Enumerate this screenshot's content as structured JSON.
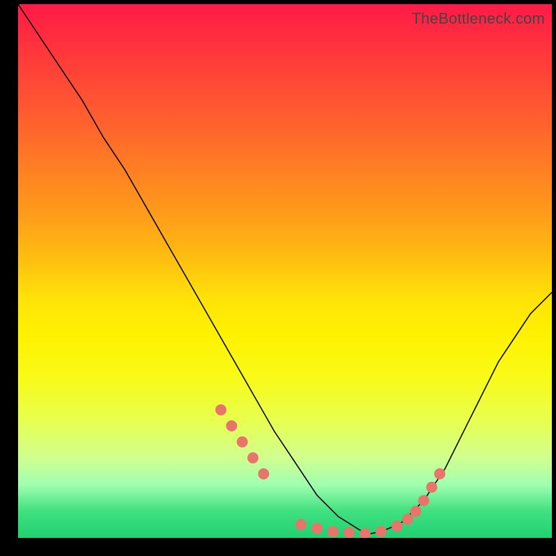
{
  "watermark": "TheBottleneck.com",
  "chart_data": {
    "type": "line",
    "title": "",
    "xlabel": "",
    "ylabel": "",
    "xlim": [
      0,
      100
    ],
    "ylim": [
      0,
      100
    ],
    "grid": false,
    "legend": false,
    "series": [
      {
        "name": "left-curve",
        "x": [
          0,
          4,
          8,
          12,
          16,
          20,
          24,
          28,
          32,
          36,
          40,
          44,
          48,
          52,
          56,
          60,
          64,
          66
        ],
        "y": [
          100,
          94,
          88,
          82,
          75,
          69,
          62,
          55,
          48,
          41,
          34,
          27,
          20,
          14,
          8,
          4,
          1.5,
          0.8
        ]
      },
      {
        "name": "right-curve",
        "x": [
          66,
          68,
          70,
          72,
          74,
          76,
          78,
          80,
          82,
          84,
          86,
          88,
          90,
          92,
          94,
          96,
          98,
          100
        ],
        "y": [
          0.8,
          1.2,
          2,
          3,
          5,
          7,
          10,
          13,
          17,
          21,
          25,
          29,
          33,
          36,
          39,
          42,
          44,
          46
        ]
      }
    ],
    "scatter_points": {
      "name": "highlight-dots",
      "x": [
        38,
        40,
        42,
        44,
        46,
        53,
        56,
        59,
        62,
        65,
        68,
        71,
        73,
        74.5,
        76,
        77.5,
        79
      ],
      "y": [
        24,
        21,
        18,
        15,
        12,
        2.5,
        1.8,
        1.2,
        1.0,
        0.8,
        1.2,
        2.2,
        3.5,
        5,
        7,
        9.5,
        12
      ]
    }
  }
}
